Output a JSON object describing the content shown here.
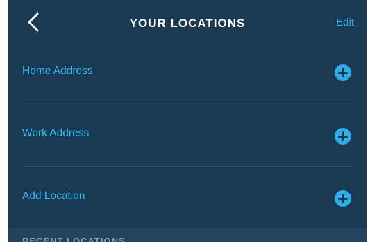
{
  "header": {
    "title": "YOUR LOCATIONS",
    "edit_label": "Edit",
    "back_icon": "chevron-left-icon"
  },
  "locations": [
    {
      "label": "Home Address",
      "icon": "plus-circle-icon"
    },
    {
      "label": "Work Address",
      "icon": "plus-circle-icon"
    },
    {
      "label": "Add Location",
      "icon": "plus-circle-icon"
    }
  ],
  "recent_section": {
    "title": "RECENT LOCATIONS"
  },
  "colors": {
    "background": "#1a3a54",
    "accent": "#2eaee6",
    "text_primary": "#ffffff",
    "section_text": "#8aa1b4"
  }
}
